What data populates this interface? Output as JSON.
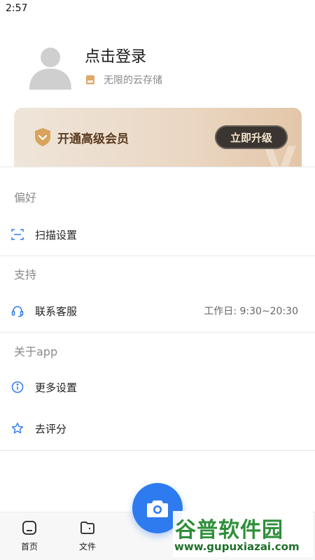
{
  "status_bar": {
    "time": "2:57"
  },
  "profile": {
    "login_title": "点击登录",
    "storage_text": "无限的云存储"
  },
  "vip_card": {
    "title": "开通高级会员",
    "upgrade_label": "立即升级"
  },
  "sections": {
    "preferences": {
      "label": "偏好",
      "items": [
        {
          "label": "扫描设置",
          "icon": "scan-icon"
        }
      ]
    },
    "support": {
      "label": "支持",
      "items": [
        {
          "label": "联系客服",
          "icon": "headset-icon",
          "right_text": "工作日: 9:30~20:30"
        }
      ]
    },
    "about": {
      "label": "关于app",
      "items": [
        {
          "label": "更多设置",
          "icon": "info-icon"
        },
        {
          "label": "去评分",
          "icon": "star-icon"
        }
      ]
    }
  },
  "bottom_nav": {
    "tabs": [
      {
        "label": "首页",
        "icon": "home-icon"
      },
      {
        "label": "文件",
        "icon": "folder-icon"
      }
    ],
    "camera": {
      "icon": "camera-icon"
    }
  },
  "watermark": {
    "title": "谷普软件园",
    "url": "www.gupuxiazai.com"
  },
  "colors": {
    "accent": "#2e7bf0",
    "vip_text": "#5a3c22",
    "upgrade_bg": "#3a3530",
    "watermark_green": "#2f8f3a"
  }
}
